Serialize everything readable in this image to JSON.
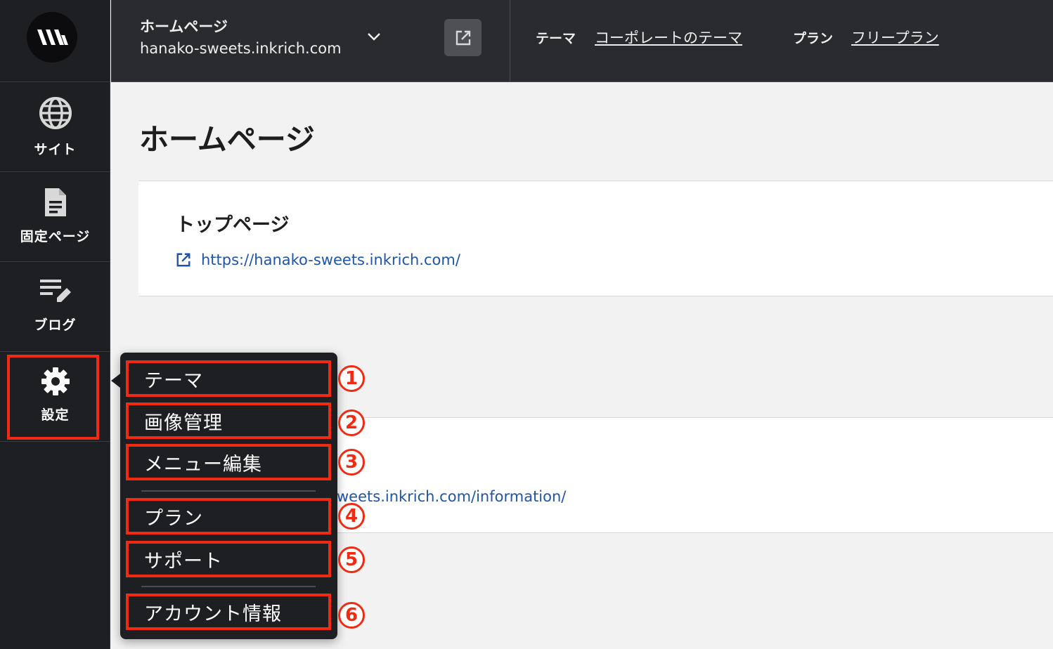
{
  "header": {
    "site_title": "ホームページ",
    "site_domain": "hanako-sweets.inkrich.com",
    "theme_label": "テーマ",
    "theme_value": "コーポレートのテーマ",
    "plan_label": "プラン",
    "plan_value": "フリープラン"
  },
  "sidebar": {
    "items": [
      {
        "label": "サイト",
        "icon": "globe-icon"
      },
      {
        "label": "固定ページ",
        "icon": "document-icon"
      },
      {
        "label": "ブログ",
        "icon": "edit-list-icon"
      },
      {
        "label": "設定",
        "icon": "gear-icon"
      }
    ]
  },
  "main": {
    "page_title": "ホームページ",
    "top_card": {
      "title": "トップページ",
      "url": "https://hanako-sweets.inkrich.com/"
    },
    "info_card": {
      "url_partial": "weets.inkrich.com/information/"
    }
  },
  "settings_menu": {
    "items": [
      {
        "label": "テーマ",
        "number": "1"
      },
      {
        "label": "画像管理",
        "number": "2"
      },
      {
        "label": "メニュー編集",
        "number": "3"
      },
      {
        "label": "プラン",
        "number": "4"
      },
      {
        "label": "サポート",
        "number": "5"
      },
      {
        "label": "アカウント情報",
        "number": "6"
      }
    ]
  },
  "colors": {
    "highlight": "#f12a12",
    "link": "#1f55a8",
    "sidebar_bg": "#1e1f23",
    "header_bg": "#2a2b2f"
  }
}
